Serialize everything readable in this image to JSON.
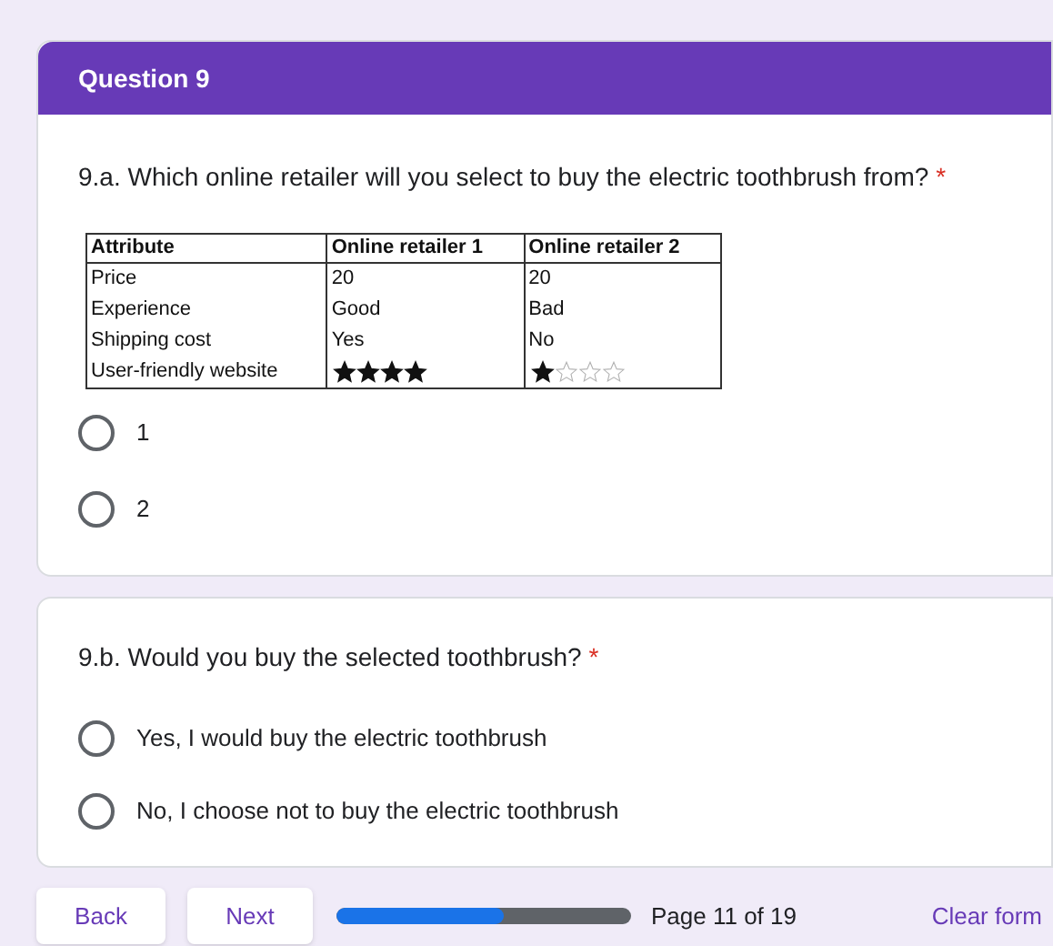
{
  "section_header": {
    "title": "Question 9"
  },
  "questions": [
    {
      "title": "9.a. Which online retailer will you select to buy the electric toothbrush from?",
      "required_mark": "*",
      "table": {
        "columns": [
          "Attribute",
          "Online retailer 1",
          "Online retailer 2"
        ],
        "rows": [
          {
            "cells": [
              {
                "kind": "text",
                "text": "Price"
              },
              {
                "kind": "text",
                "text": "20"
              },
              {
                "kind": "text",
                "text": "20"
              }
            ]
          },
          {
            "cells": [
              {
                "kind": "text",
                "text": "Experience"
              },
              {
                "kind": "text",
                "text": "Good"
              },
              {
                "kind": "text",
                "text": "Bad"
              }
            ]
          },
          {
            "cells": [
              {
                "kind": "text",
                "text": "Shipping cost"
              },
              {
                "kind": "text",
                "text": "Yes"
              },
              {
                "kind": "text",
                "text": "No"
              }
            ]
          },
          {
            "cells": [
              {
                "kind": "text",
                "text": "User-friendly website"
              },
              {
                "kind": "stars",
                "stars": 4
              },
              {
                "kind": "stars",
                "stars": 1
              }
            ]
          }
        ]
      },
      "options": [
        {
          "label": "1",
          "selected": false
        },
        {
          "label": "2",
          "selected": false
        }
      ]
    },
    {
      "title": "9.b. Would you buy the selected toothbrush?",
      "required_mark": "*",
      "options": [
        {
          "label": "Yes, I would buy the electric toothbrush",
          "selected": false
        },
        {
          "label": "No, I choose not to buy the electric toothbrush",
          "selected": false
        }
      ]
    }
  ],
  "footer": {
    "back": "Back",
    "next": "Next",
    "progress": {
      "level": 0.57
    },
    "page": "Page 11 of 19",
    "clear": "Clear form"
  }
}
